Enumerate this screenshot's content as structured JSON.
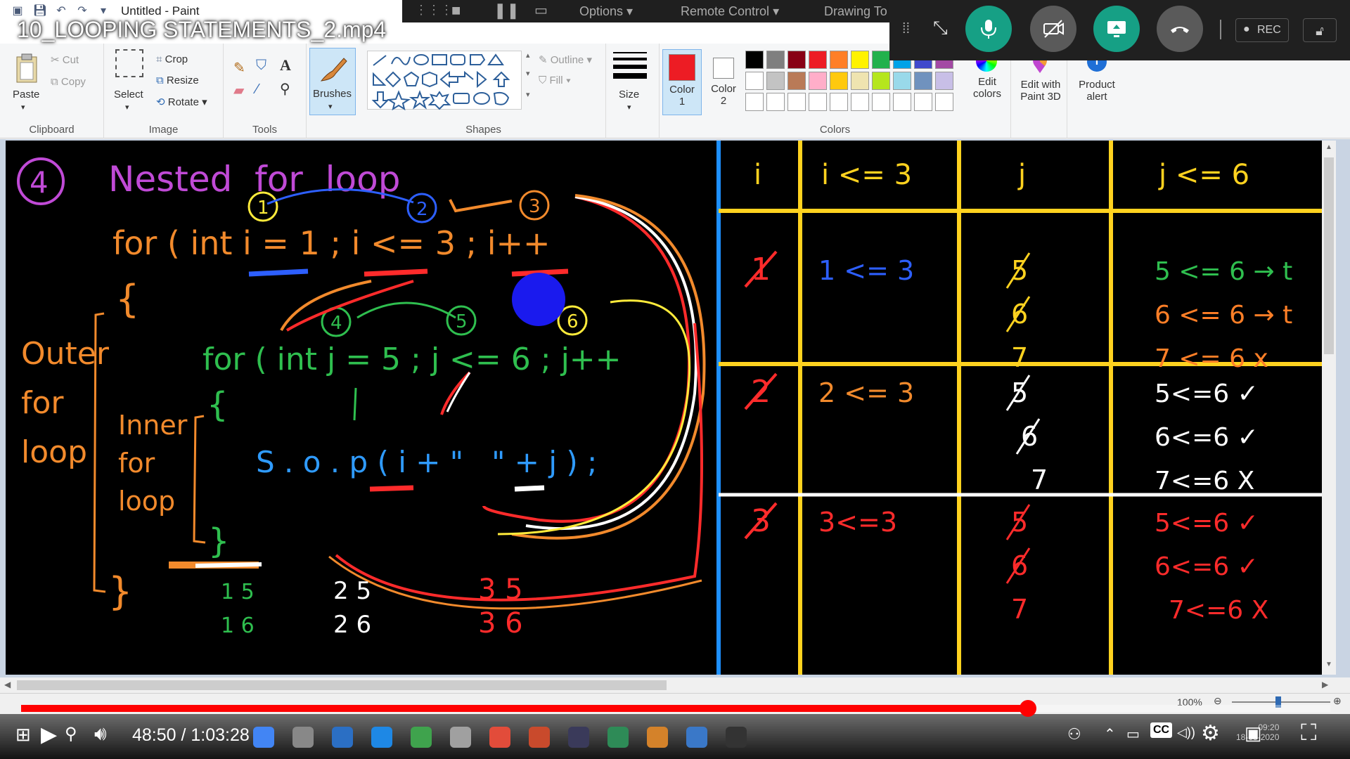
{
  "paint": {
    "app_title": "Untitled - Paint",
    "clipboard": {
      "paste": "Paste",
      "cut": "Cut",
      "copy": "Copy",
      "label": "Clipboard"
    },
    "image": {
      "select": "Select",
      "crop": "Crop",
      "resize": "Resize",
      "rotate": "Rotate",
      "label": "Image"
    },
    "tools": {
      "label": "Tools"
    },
    "brushes": {
      "label": "Brushes"
    },
    "shapes": {
      "outline": "Outline",
      "fill": "Fill",
      "label": "Shapes"
    },
    "size": {
      "label": "Size"
    },
    "colors": {
      "color1": "Color\n1",
      "color2": "Color\n2",
      "edit": "Edit colors",
      "label": "Colors",
      "color1_value": "#ed1c24",
      "color2_value": "#ffffff",
      "palette_row1": [
        "#000000",
        "#7f7f7f",
        "#880015",
        "#ed1c24",
        "#ff7f27",
        "#fff200",
        "#22b14c",
        "#00a2e8",
        "#3f48cc",
        "#a349a4"
      ],
      "palette_row2": [
        "#ffffff",
        "#c3c3c3",
        "#b97a57",
        "#ffaec9",
        "#ffc90e",
        "#efe4b0",
        "#b5e61d",
        "#99d9ea",
        "#7092be",
        "#c8bfe7"
      ]
    },
    "edit_paint3d": "Edit with Paint 3D",
    "product_alert": "Product alert",
    "status": {
      "zoom": "100%"
    }
  },
  "remote": {
    "options": "Options",
    "remote_control": "Remote Control",
    "drawing": "Drawing To"
  },
  "meeting": {
    "rec": "REC"
  },
  "video": {
    "title": "10_LOOPING STATEMENTS_2.mp4",
    "current_time": "48:50",
    "duration": "1:03:28",
    "time_display": "48:50 / 1:03:28",
    "progress_fraction": 0.769
  },
  "taskbar": {
    "clock_time": "09:20",
    "clock_date": "18-08-2020"
  },
  "board": {
    "heading_num": "4",
    "heading": "Nested  for  loop",
    "outer_code": "for ( int i = 1 ; i <= 3 ; i++",
    "inner_code": "for ( int j = 5 ; j <= 6 ; j++",
    "print_code": "S . o . p ( i + \"   \" + j ) ;",
    "outer_label": [
      "Outer",
      "for",
      "loop"
    ],
    "inner_label": [
      "Inner",
      "for",
      "loop"
    ],
    "steps": [
      "1",
      "2",
      "3",
      "4",
      "5",
      "6"
    ],
    "output_pairs": [
      {
        "a": "1 5",
        "b": "1 6"
      },
      {
        "a": "2  5",
        "b": "2  6"
      },
      {
        "a": "3 5",
        "b": "3 6"
      }
    ],
    "table": {
      "headers": [
        "i",
        "i <= 3",
        "j",
        "j <= 6"
      ],
      "rows": [
        {
          "i": "1",
          "cond": "1 <= 3",
          "j": [
            "5",
            "6",
            "7"
          ],
          "jcond": [
            "5 <= 6 → t",
            "6 <= 6 → t",
            "7 <= 6   x"
          ]
        },
        {
          "i": "2",
          "cond": "2 <= 3",
          "j": [
            "5",
            "6",
            "7"
          ],
          "jcond": [
            "5<=6 ✓",
            "6<=6 ✓",
            "7<=6  X"
          ]
        },
        {
          "i": "3",
          "cond": "3<=3",
          "j": [
            "5",
            "6",
            "7"
          ],
          "jcond": [
            "5<=6 ✓",
            "6<=6 ✓",
            "7<=6 X"
          ]
        }
      ]
    }
  }
}
